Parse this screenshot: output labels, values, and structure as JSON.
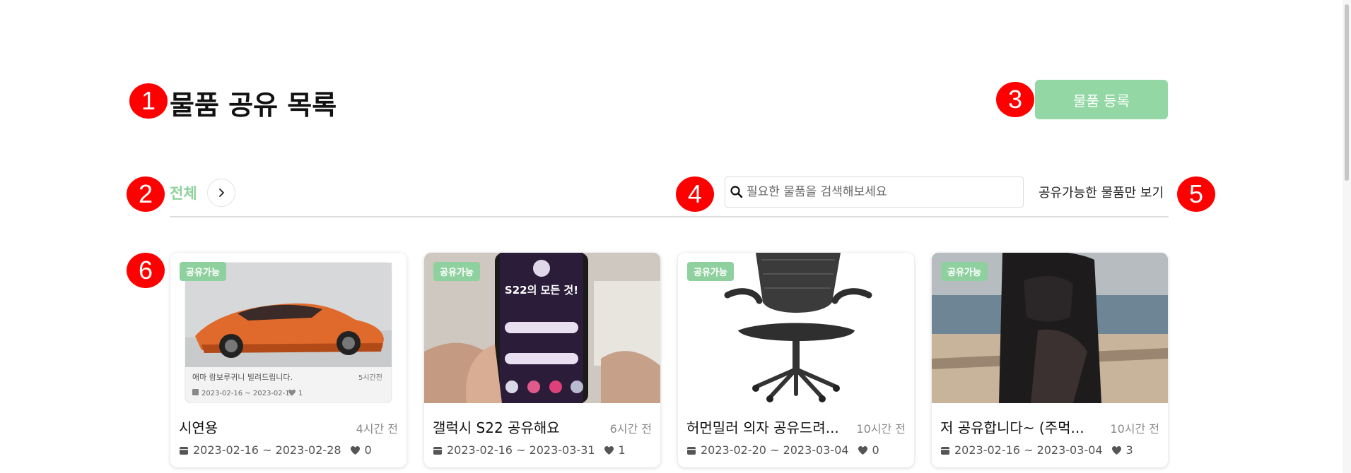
{
  "markers": [
    "1",
    "2",
    "3",
    "4",
    "5",
    "6"
  ],
  "header": {
    "title": "물품 공유 목록",
    "register_label": "물품 등록"
  },
  "filter": {
    "category_label": "전체",
    "search_placeholder": "필요한 물품을 검색해보세요",
    "available_only_label": "공유가능한 물품만 보기"
  },
  "colors": {
    "accent": "#8fd19e",
    "marker": "#ff0000"
  },
  "items": [
    {
      "badge": "공유가능",
      "title": "시연용",
      "time": "4시간 전",
      "period": "2023-02-16 ~ 2023-02-28",
      "likes": "0",
      "image": "lamborghini-screenshot",
      "inner_title": "애마 람보루귀니 빌려드립니다.",
      "inner_time": "5시간전",
      "inner_period": "2023-02-16 ~ 2023-02-19",
      "inner_likes": "1"
    },
    {
      "badge": "공유가능",
      "title": "갤럭시 S22 공유해요",
      "time": "6시간 전",
      "period": "2023-02-16 ~ 2023-03-31",
      "likes": "1",
      "image": "phone-in-hand",
      "inner_title": "S22의 모든 것!",
      "inner_time": "",
      "inner_period": "",
      "inner_likes": ""
    },
    {
      "badge": "공유가능",
      "title": "허먼밀러 의자 공유드려...",
      "time": "10시간 전",
      "period": "2023-02-20 ~ 2023-03-04",
      "likes": "0",
      "image": "office-chair"
    },
    {
      "badge": "공유가능",
      "title": "저 공유합니다~ (주먹...",
      "time": "10시간 전",
      "period": "2023-02-16 ~ 2023-03-04",
      "likes": "3",
      "image": "beach-photo"
    }
  ]
}
